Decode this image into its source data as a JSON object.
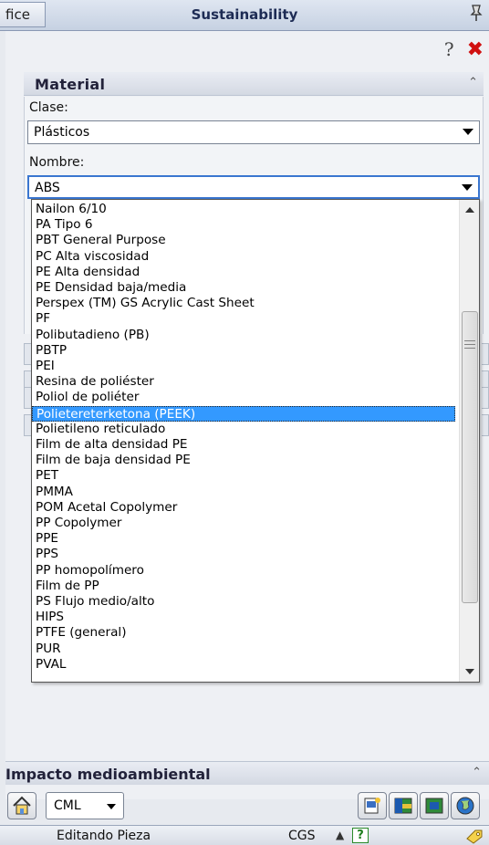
{
  "window": {
    "left_tab_fragment": "fice",
    "title": "Sustainability"
  },
  "material": {
    "section_title": "Material",
    "class_label": "Clase:",
    "class_value": "Plásticos",
    "name_label": "Nombre:",
    "name_value": "ABS",
    "options": [
      "Nailon 6/10",
      "PA Tipo 6",
      "PBT General Purpose",
      "PC Alta viscosidad",
      "PE Alta densidad",
      "PE Densidad baja/media",
      "Perspex (TM) GS Acrylic Cast Sheet",
      "PF",
      "Polibutadieno (PB)",
      "PBTP",
      "PEI",
      "Resina de poliéster",
      "Poliol de poliéter",
      "Polietereterketona (PEEK)",
      "Polietileno reticulado",
      "Film de alta densidad PE",
      "Film de baja densidad PE",
      "PET",
      "PMMA",
      "POM Acetal Copolymer",
      "PP Copolymer",
      "PPE",
      "PPS",
      "PP homopolímero",
      "Film de PP",
      "PS Flujo medio/alto",
      "HIPS",
      "PTFE (general)",
      "PUR",
      "PVAL"
    ],
    "highlighted_option": "Polietereterketona (PEEK)"
  },
  "impact": {
    "section_title": "Impacto medioambiental",
    "method_value": "CML"
  },
  "status": {
    "mode_text": "Editando Pieza",
    "units": "CGS",
    "help_glyph": "?"
  },
  "icons": {
    "help": "question-icon",
    "close": "close-icon",
    "pin": "pin-icon",
    "home": "home-icon",
    "report": "report-icon",
    "import": "import-icon",
    "export": "export-icon",
    "globe": "globe-icon"
  },
  "colors": {
    "selection": "#3399ff",
    "close": "#d01010",
    "focus": "#3a76d0"
  }
}
